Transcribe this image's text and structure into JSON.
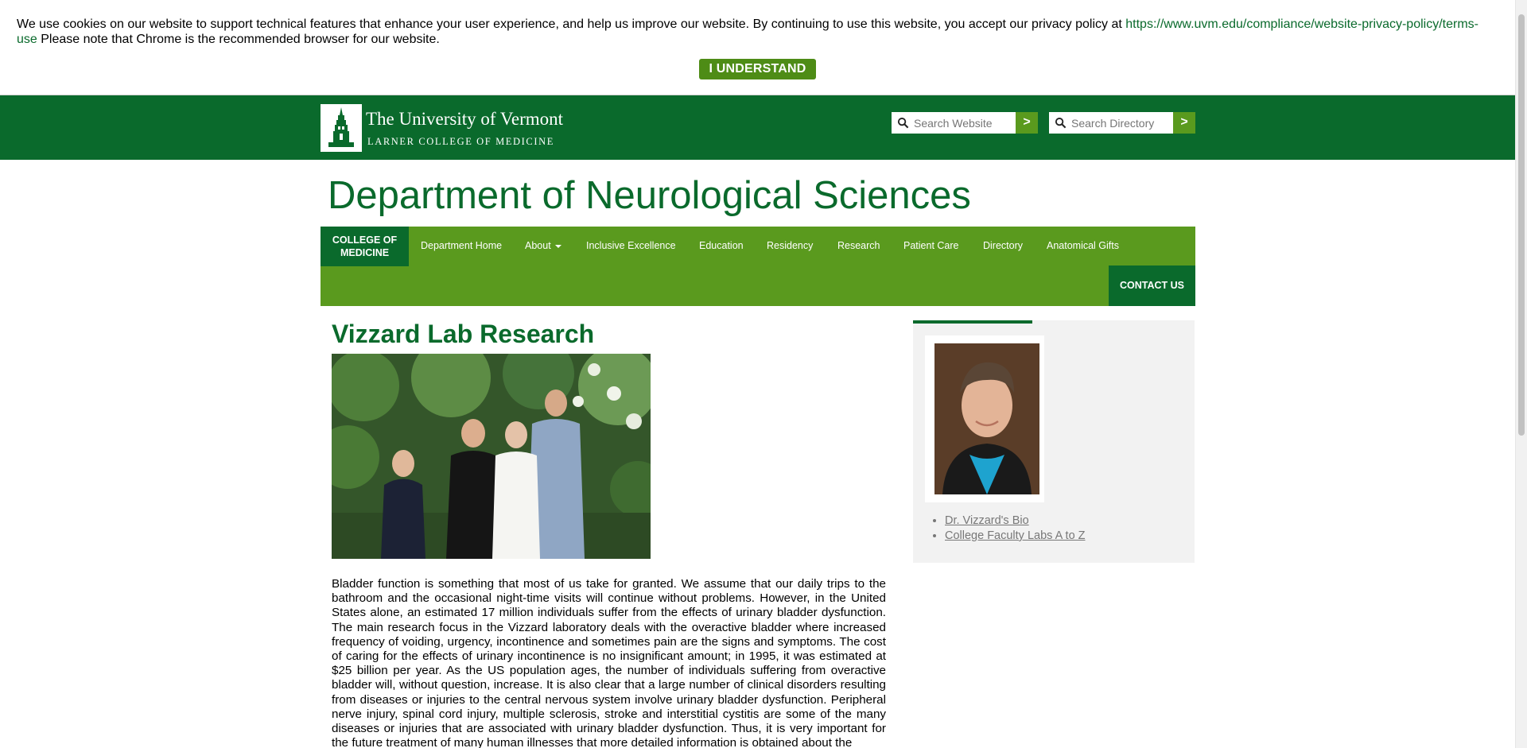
{
  "cookie_banner": {
    "message": "We use cookies on our website to support technical features that enhance your user experience, and help us improve our website. By continuing to use this website, you accept our privacy policy at ",
    "policy_link": "https://www.uvm.edu/compliance/website-privacy-policy/terms-use",
    "message_end": " Please note that Chrome is the recommended browser for our website.",
    "button_label": "I UNDERSTAND"
  },
  "header": {
    "logo_university": "The University of Vermont",
    "logo_college": "LARNER COLLEGE OF MEDICINE",
    "search_website_placeholder": "Search Website",
    "search_directory_placeholder": "Search Directory",
    "go_label": ">"
  },
  "dept_title": "Department of Neurological Sciences",
  "nav": {
    "home_line1": "COLLEGE OF",
    "home_line2": "MEDICINE",
    "items": [
      "Department Home",
      "About",
      "Inclusive Excellence",
      "Education",
      "Residency",
      "Research",
      "Patient Care",
      "Directory",
      "Anatomical Gifts"
    ],
    "contact": "CONTACT US"
  },
  "main": {
    "title": "Vizzard Lab Research",
    "body": "Bladder function is something that most of us take for granted. We assume that our daily trips to the bathroom and the occasional night-time visits will continue without problems. However, in the United States alone, an estimated 17 million individuals suffer from the effects of urinary bladder dysfunction. The main research focus in the Vizzard laboratory deals with the overactive bladder where increased frequency of voiding, urgency, incontinence and sometimes pain are the signs and symptoms. The cost of caring for the effects of urinary incontinence is no insignificant amount; in 1995, it was estimated at $25 billion per year. As the US population ages, the number of individuals suffering from overactive bladder will, without question, increase. It is also clear that a large number of clinical disorders resulting from diseases or injuries to the central nervous system involve urinary bladder dysfunction. Peripheral nerve injury, spinal cord injury, multiple sclerosis, stroke and interstitial cystitis are some of the many diseases or injuries that are associated with urinary bladder dysfunction. Thus, it is very important for the future treatment of many human illnesses that more detailed information is obtained about the"
  },
  "sidebar": {
    "links": [
      "Dr. Vizzard's Bio",
      "College Faculty Labs A to Z"
    ]
  }
}
